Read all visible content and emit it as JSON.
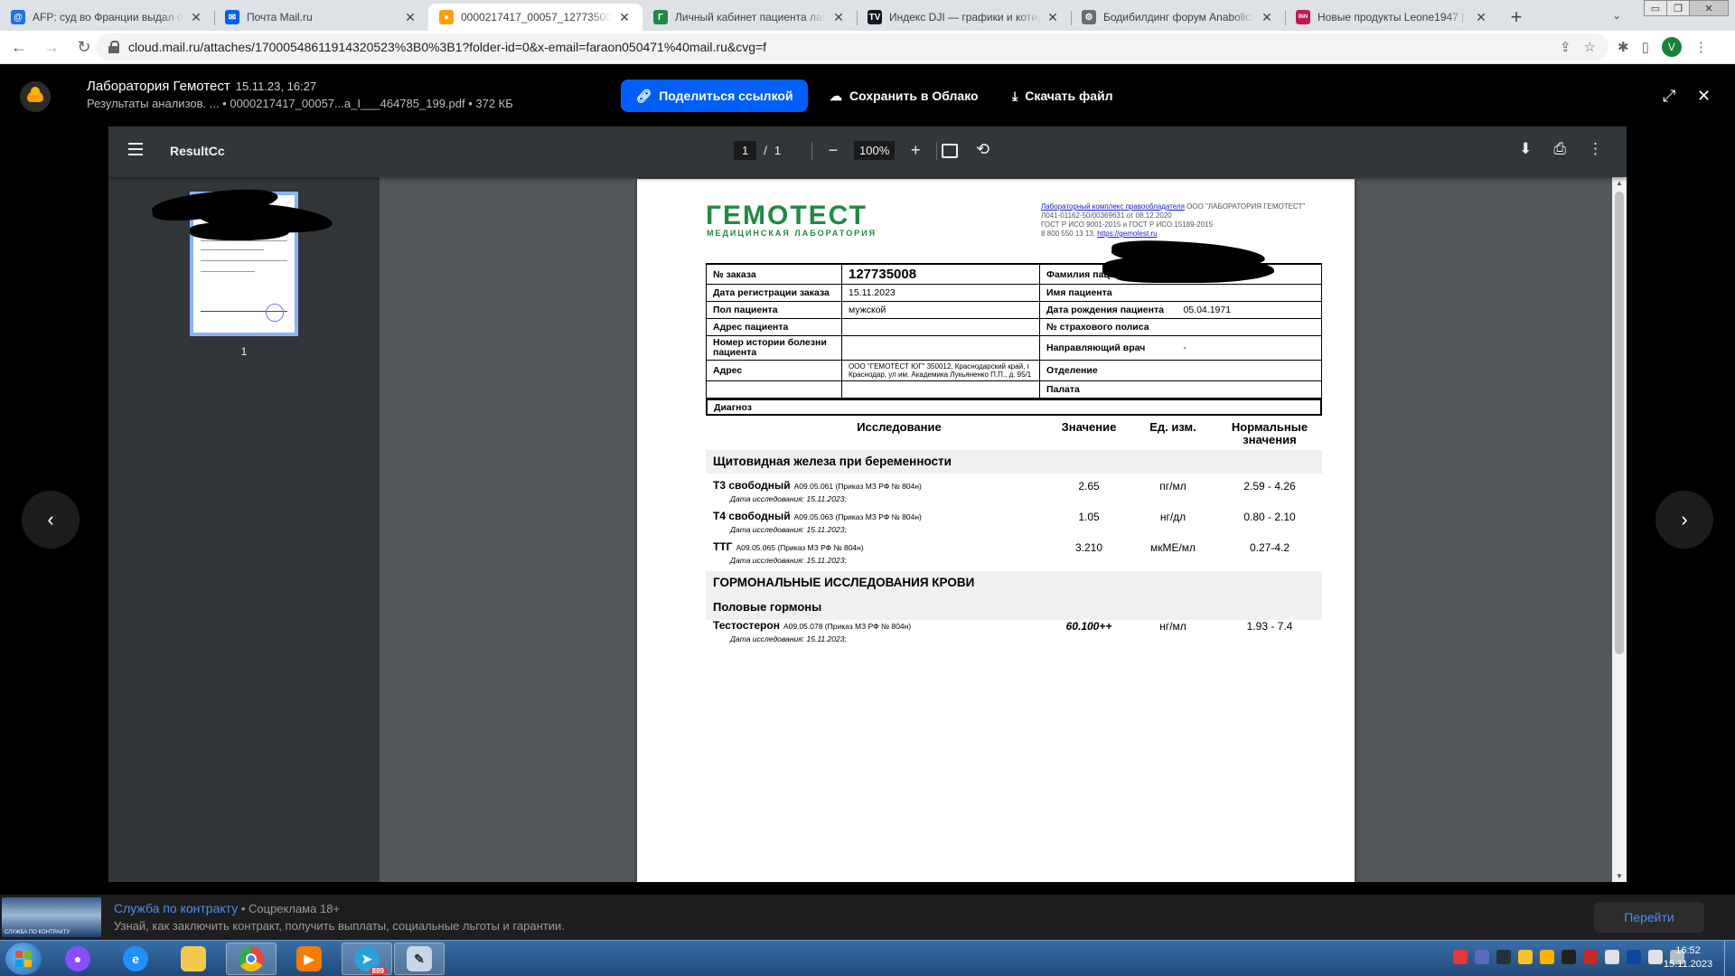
{
  "browser": {
    "tabs": [
      {
        "title": "AFP: суд во Франции выдал ордер",
        "favicon_color": "#1a73e8",
        "favicon_glyph": "@",
        "active": false
      },
      {
        "title": "Почта Mail.ru",
        "favicon_color": "#005ff9",
        "favicon_glyph": "✉",
        "active": false
      },
      {
        "title": "0000217417_00057_127735008_с",
        "favicon_color": "#ff9e00",
        "favicon_glyph": "●",
        "active": true
      },
      {
        "title": "Личный кабинет пациента лабо",
        "favicon_color": "#1f8a43",
        "favicon_glyph": "Г",
        "active": false
      },
      {
        "title": "Индекс DJI — графики и котиро",
        "favicon_color": "#131722",
        "favicon_glyph": "TV",
        "active": false
      },
      {
        "title": "Бодибилдинг форум AnabolicSh",
        "favicon_color": "#6d6d6d",
        "favicon_glyph": "⚙",
        "active": false
      },
      {
        "title": "Новые продукты Leone1947 | Тr",
        "favicon_color": "#c2185b",
        "favicon_glyph": "INN",
        "active": false
      }
    ],
    "url": "cloud.mail.ru/attaches/17000548611914320523%3B0%3B1?folder-id=0&x-email=faraon050471%40mail.ru&cvg=f",
    "profile_initial": "V",
    "icons": {
      "back": "arrow-left-icon",
      "forward": "arrow-right-icon",
      "reload": "reload-icon",
      "share": "share-icon",
      "bookmark": "star-icon",
      "extensions": "puzzle-icon",
      "sidepanel": "side-panel-icon",
      "menu": "kebab-icon"
    }
  },
  "cloud": {
    "title": "Лаборатория Гемотест",
    "date": "15.11.23, 16:27",
    "subtitle": "Результаты анализов. ...  • 0000217417_00057...а_I___464785_199.pdf • 372 КБ",
    "share_label": "Поделиться ссылкой",
    "save_label": "Сохранить в Облако",
    "download_label": "Скачать файл",
    "brand_color": "#005ff9"
  },
  "pdf_viewer": {
    "file_name": "ResultCc",
    "page_current": "1",
    "page_sep": "/",
    "page_total": "1",
    "zoom": "100%",
    "thumb_label": "1"
  },
  "document": {
    "logo": "ГЕМОТЕСТ",
    "logo_sub": "МЕДИЦИНСКАЯ ЛАБОРАТОРИЯ",
    "lab_link": "Лабораторный комплекс правообладателя",
    "lab_owner": " ООО \"ЛАБОРАТОРИЯ ГЕМОТЕСТ\"",
    "lab_license": "Л041-01162-50/00369631 от 08.12.2020",
    "lab_gost": "ГОСТ Р ИСО 9001-2015 и ГОСТ Р ИСО 15189-2015",
    "lab_phone": "8 800 550 13 13, ",
    "lab_site": "https://gemotest.ru",
    "info": {
      "order_label": "№ заказа",
      "order_value": "127735008",
      "lastname_label": "Фамилия паци",
      "reg_label": "Дата регистрации заказа",
      "reg_value": "15.11.2023",
      "firstname_label": "Имя пациента",
      "sex_label": "Пол пациента",
      "sex_value": "мужской",
      "dob_label": "Дата рождения пациента",
      "dob_value": "05.04.1971",
      "address_label": "Адрес пациента",
      "policy_label": "№ страхового полиса",
      "history_label": "Номер истории болезни пациента",
      "doctor_label": "Направляющий врач",
      "doctor_value": "-",
      "addr_label": "Адрес",
      "addr_value": "ООО \"ГЕМОТЕСТ ЮГ\" 350012, Краснодарский край, г Краснодар, ул им. Академика Лукьяненко П.П., д. 95/1",
      "dept_label": "Отделение",
      "ward_label": "Палата",
      "diag_label": "Диагноз"
    },
    "columns": {
      "study": "Исследование",
      "value": "Значение",
      "unit": "Ед. изм.",
      "norm": "Нормальные значения"
    },
    "section_thyroid": "Щитовидная железа при беременности",
    "section_hormones": "ГОРМОНАЛЬНЫЕ ИССЛЕДОВАНИЯ КРОВИ",
    "section_sex": "Половые гормоны",
    "results": [
      {
        "name": "Т3 свободный",
        "code": "A09.05.061 (Приказ МЗ РФ № 804н)",
        "date": "Дата исследования: 15.11.2023;",
        "value": "2.65",
        "unit": "пг/мл",
        "norm": "2.59 - 4.26"
      },
      {
        "name": "Т4 свободный",
        "code": "A09.05.063 (Приказ МЗ РФ № 804н)",
        "date": "Дата исследования: 15.11.2023;",
        "value": "1.05",
        "unit": "нг/дл",
        "norm": "0.80 - 2.10"
      },
      {
        "name": "ТТГ",
        "code": "A09.05.065 (Приказ МЗ РФ № 804н)",
        "date": "Дата исследования: 15.11.2023;",
        "value": "3.210",
        "unit": "мкМЕ/мл",
        "norm": "0.27-4.2"
      },
      {
        "name": "Тестостерон",
        "code": "A09.05.078 (Приказ МЗ РФ № 804н)",
        "date": "Дата исследования: 15.11.2023;",
        "value": "60.100++",
        "unit": "нг/мл",
        "norm": "1.93 - 7.4"
      }
    ]
  },
  "ad": {
    "link": "Служба по контракту",
    "meta": " • Соцреклама 18+",
    "text": "Узнай, как заключить контракт, получить выплаты, социальные льготы и гарантии.",
    "button": "Перейти",
    "image_caption": "СЛУЖБА ПО КОНТРАКТУ"
  },
  "taskbar": {
    "telegram_badge": "889",
    "time": "16:52",
    "date": "15.11.2023"
  }
}
